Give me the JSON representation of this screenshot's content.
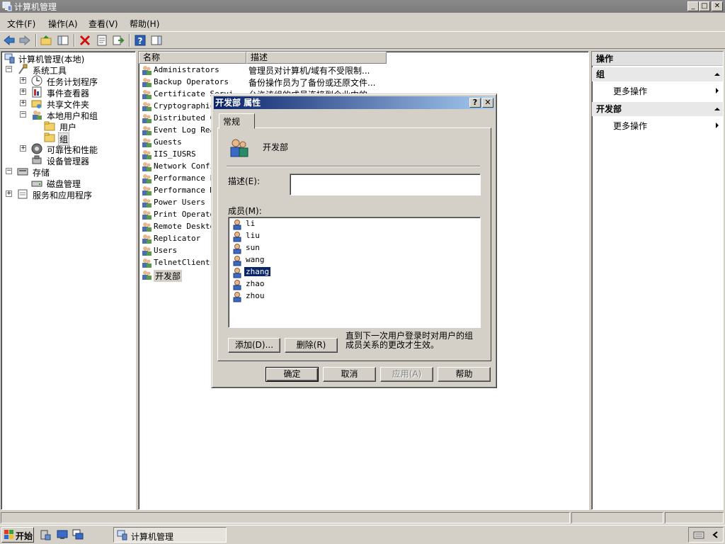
{
  "window": {
    "title": "计算机管理",
    "min": "_",
    "max": "□",
    "close": "✕"
  },
  "menu": [
    "文件(F)",
    "操作(A)",
    "查看(V)",
    "帮助(H)"
  ],
  "tree": {
    "root": "计算机管理(本地)",
    "system_tools": "系统工具",
    "task_scheduler": "任务计划程序",
    "event_viewer": "事件查看器",
    "shared_folders": "共享文件夹",
    "local_users_groups": "本地用户和组",
    "users": "用户",
    "groups": "组",
    "reliability": "可靠性和性能",
    "device_manager": "设备管理器",
    "storage": "存储",
    "disk_management": "磁盘管理",
    "services_apps": "服务和应用程序"
  },
  "list": {
    "col_name": "名称",
    "col_desc": "描述",
    "rows": [
      {
        "name": "Administrators",
        "desc": "管理员对计算机/域有不受限制..."
      },
      {
        "name": "Backup Operators",
        "desc": "备份操作员为了备份或还原文件..."
      },
      {
        "name": "Certificate Servi",
        "desc": "允许该组的成员连接到企业中的"
      },
      {
        "name": "Cryptographic",
        "desc": ""
      },
      {
        "name": "Distributed CO",
        "desc": ""
      },
      {
        "name": "Event Log Read",
        "desc": ""
      },
      {
        "name": "Guests",
        "desc": ""
      },
      {
        "name": "IIS_IUSRS",
        "desc": ""
      },
      {
        "name": "Network Config",
        "desc": ""
      },
      {
        "name": "Performance Lo",
        "desc": ""
      },
      {
        "name": "Performance Mo",
        "desc": ""
      },
      {
        "name": "Power Users",
        "desc": ""
      },
      {
        "name": "Print Operator",
        "desc": ""
      },
      {
        "name": "Remote Desktop",
        "desc": ""
      },
      {
        "name": "Replicator",
        "desc": ""
      },
      {
        "name": "Users",
        "desc": ""
      },
      {
        "name": "TelnetClients",
        "desc": ""
      },
      {
        "name": "开发部",
        "desc": ""
      }
    ]
  },
  "actions": {
    "header": "操作",
    "section1": "组",
    "section1_item": "更多操作",
    "section2": "开发部",
    "section2_item": "更多操作"
  },
  "dialog": {
    "title": "开发部 属性",
    "help_btn": "?",
    "close_btn": "✕",
    "tab": "常规",
    "group_name": "开发部",
    "desc_label": "描述(E):",
    "desc_value": "",
    "members_label": "成员(M):",
    "members": [
      "li",
      "liu",
      "sun",
      "wang",
      "zhang",
      "zhao",
      "zhou"
    ],
    "selected_member": "zhang",
    "add": "添加(D)...",
    "remove": "删除(R)",
    "note": "直到下一次用户登录时对用户的组成员关系的更改才生效。",
    "ok": "确定",
    "cancel": "取消",
    "apply": "应用(A)",
    "help": "帮助"
  },
  "taskbar": {
    "start": "开始",
    "task": "计算机管理"
  }
}
